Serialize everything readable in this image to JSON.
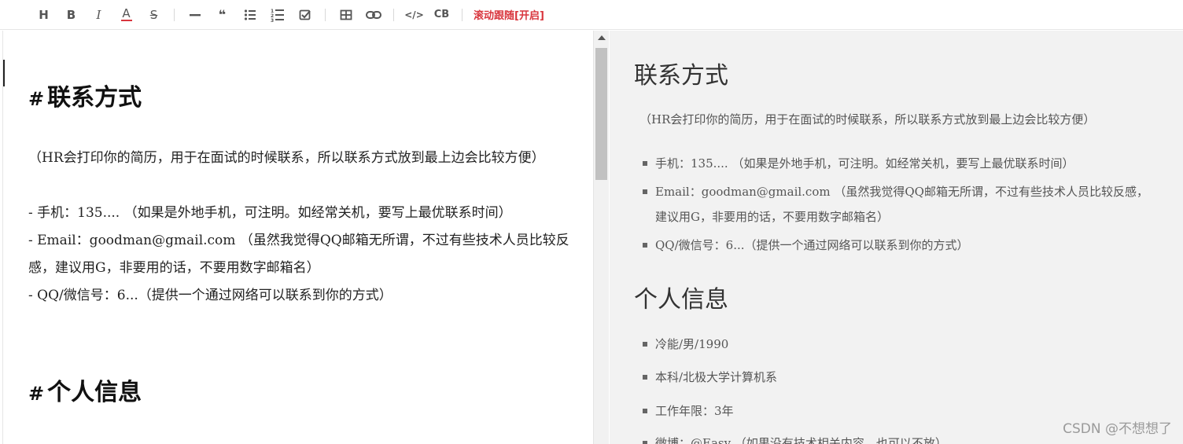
{
  "toolbar": {
    "buttons": [
      {
        "label": "H",
        "icon": "heading-icon"
      },
      {
        "label": "B",
        "icon": "bold-icon"
      },
      {
        "label": "I",
        "icon": "italic-icon"
      },
      {
        "label": "A",
        "icon": "font-color-icon"
      },
      {
        "label": "S",
        "icon": "strikethrough-icon"
      },
      {
        "icon": "horizontal-rule-icon"
      },
      {
        "label": "❝",
        "icon": "blockquote-icon"
      },
      {
        "icon": "unordered-list-icon"
      },
      {
        "icon": "ordered-list-icon"
      },
      {
        "icon": "task-list-icon"
      },
      {
        "icon": "table-icon"
      },
      {
        "icon": "link-icon"
      },
      {
        "label": "</>",
        "icon": "code-icon"
      },
      {
        "label": "CB",
        "icon": "code-block-icon"
      }
    ],
    "scroll_follow_label": "滚动跟随[开启]",
    "accent_color": "#d9363e"
  },
  "editor": {
    "hash": "#",
    "heading1": "联系方式",
    "para": "（HR会打印你的简历，用于在面试的时候联系，所以联系方式放到最上边会比较方便）",
    "line1": "- 手机：135.... （如果是外地手机，可注明。如经常关机，要写上最优联系时间）",
    "line2a": "- Email：goodman@gmail.com （虽然我觉得QQ邮箱无所谓，不过有些技术人员比较反",
    "line2b": "感，建议用G，非要用的话，不要用数字邮箱名）",
    "line3": "- QQ/微信号：6...（提供一个通过网络可以联系到你的方式）",
    "heading2": "个人信息"
  },
  "preview": {
    "heading1": "联系方式",
    "para": "（HR会打印你的简历，用于在面试的时候联系，所以联系方式放到最上边会比较方便）",
    "contact_items": [
      "手机：135.... （如果是外地手机，可注明。如经常关机，要写上最优联系时间）",
      "Email：goodman@gmail.com （虽然我觉得QQ邮箱无所谓，不过有些技术人员比较反感，",
      "建议用G，非要用的话，不要用数字邮箱名）",
      "QQ/微信号：6...（提供一个通过网络可以联系到你的方式）"
    ],
    "heading2": "个人信息",
    "info_items": [
      "冷能/男/1990",
      "本科/北极大学计算机系",
      "工作年限：3年",
      "微博：@Easy （如果没有技术相关内容，也可以不放）"
    ]
  },
  "watermark": "CSDN @不想想了"
}
